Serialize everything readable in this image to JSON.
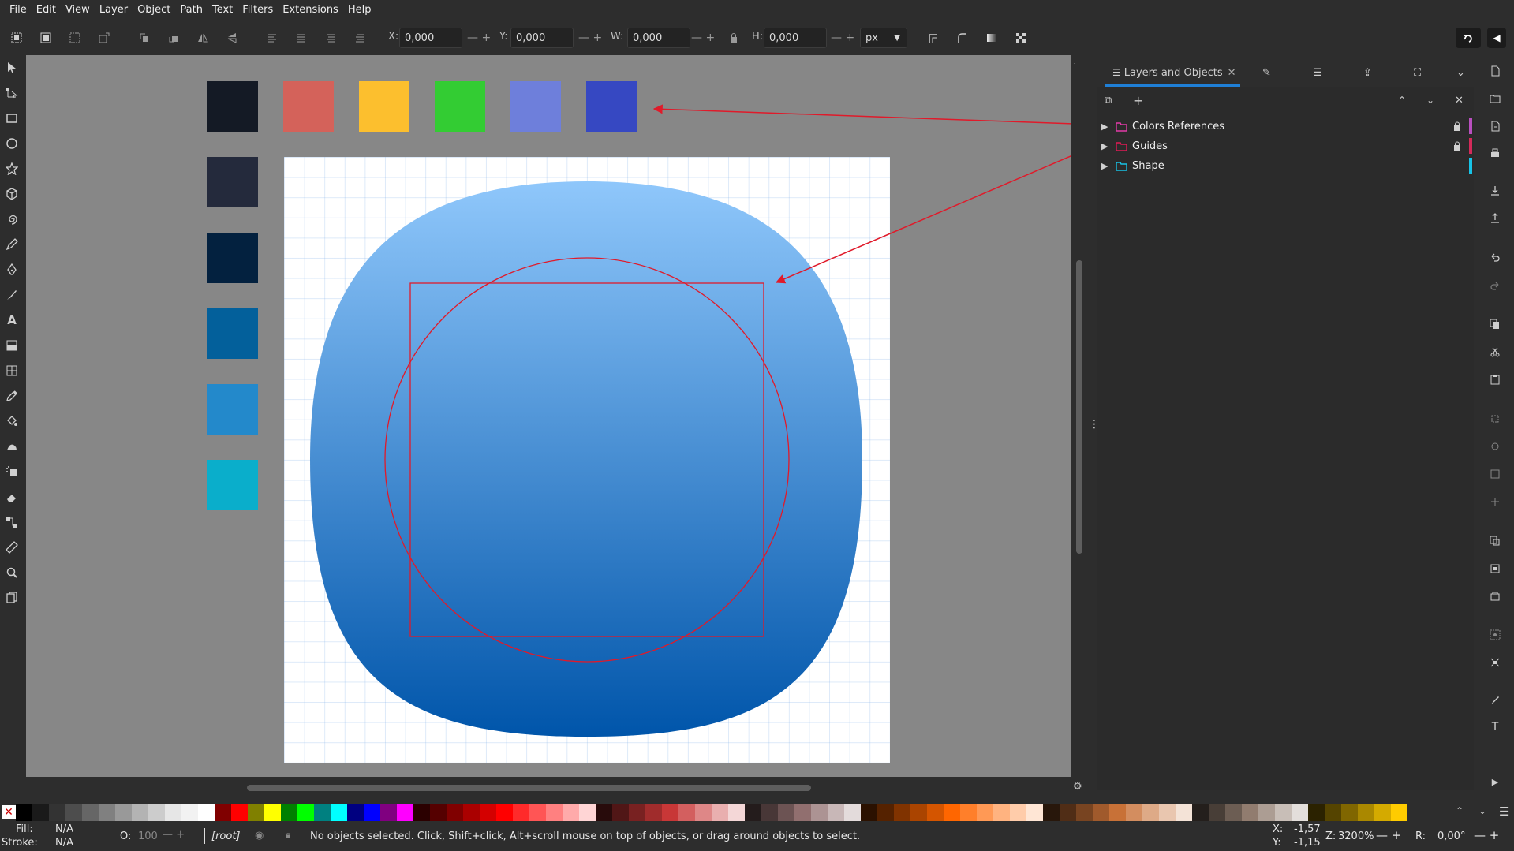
{
  "menu": [
    "File",
    "Edit",
    "View",
    "Layer",
    "Object",
    "Path",
    "Text",
    "Filters",
    "Extensions",
    "Help"
  ],
  "toolbar": {
    "x_label": "X:",
    "x_value": "0,000",
    "y_label": "Y:",
    "y_value": "0,000",
    "w_label": "W:",
    "w_value": "0,000",
    "h_label": "H:",
    "h_value": "0,000",
    "unit": "px"
  },
  "canvas": {
    "swatches_row": [
      "#141a25",
      "#d4625a",
      "#fcbf2e",
      "#33cc33",
      "#6e7fdb",
      "#3648c2"
    ],
    "swatches_col": [
      "#242a3c",
      "#03213f",
      "#03609b",
      "#2389cb",
      "#0aaecb"
    ],
    "shape_gradient_top": "#8fc7fb",
    "shape_gradient_bottom": "#0055aa",
    "guide_color": "#e01a2a"
  },
  "dock": {
    "tab_layers": "Layers and Objects",
    "layers": [
      {
        "name": "Colors References",
        "folder_color": "#e23ba8",
        "locked": true,
        "bar_color": "#b94fbf"
      },
      {
        "name": "Guides",
        "folder_color": "#e01a55",
        "locked": true,
        "bar_color": "#d42a5a"
      },
      {
        "name": "Shape",
        "folder_color": "#17c3e6",
        "locked": false,
        "bar_color": "#17c3e6"
      }
    ]
  },
  "palette_colors": [
    "#000000",
    "#1a1a1a",
    "#333333",
    "#4d4d4d",
    "#666666",
    "#808080",
    "#999999",
    "#b3b3b3",
    "#cccccc",
    "#e6e6e6",
    "#f2f2f2",
    "#ffffff",
    "#800000",
    "#ff0000",
    "#808000",
    "#ffff00",
    "#008000",
    "#00ff00",
    "#008080",
    "#00ffff",
    "#000080",
    "#0000ff",
    "#800080",
    "#ff00ff",
    "#2b0000",
    "#550000",
    "#800000",
    "#aa0000",
    "#d40000",
    "#ff0000",
    "#ff2a2a",
    "#ff5555",
    "#ff8080",
    "#ffaaaa",
    "#ffd5d5",
    "#280b0b",
    "#501616",
    "#782121",
    "#a02c2c",
    "#c83737",
    "#d35f5f",
    "#de8787",
    "#e9afaf",
    "#f4d7d7",
    "#241c1c",
    "#483737",
    "#6c5353",
    "#916f6f",
    "#ac9393",
    "#c8b7b7",
    "#e3dbdb",
    "#2b1100",
    "#552200",
    "#803300",
    "#aa4400",
    "#d45500",
    "#ff6600",
    "#ff7f2a",
    "#ff9955",
    "#ffb380",
    "#ffccaa",
    "#ffe6d5",
    "#28170b",
    "#502d16",
    "#784421",
    "#a05a2c",
    "#c87137",
    "#d38d5f",
    "#deaa87",
    "#e9c6af",
    "#f4e3d7",
    "#241f1c",
    "#483e37",
    "#6c5d53",
    "#917c6f",
    "#ac9d93",
    "#c8beb7",
    "#e3dedb",
    "#2b2200",
    "#554400",
    "#806600",
    "#aa8800",
    "#d4aa00",
    "#ffcc00"
  ],
  "status": {
    "fill_label": "Fill:",
    "fill_value": "N/A",
    "stroke_label": "Stroke:",
    "stroke_value": "N/A",
    "opacity_label": "O:",
    "opacity_value": "100",
    "layer": "[root]",
    "message": "No objects selected. Click, Shift+click, Alt+scroll mouse on top of objects, or drag around objects to select.",
    "x_label": "X:",
    "x_value": "-1,57",
    "y_label": "Y:",
    "y_value": "-1,15",
    "zoom_label": "Z:",
    "zoom_value": "3200%",
    "rot_label": "R:",
    "rot_value": "0,00°"
  }
}
